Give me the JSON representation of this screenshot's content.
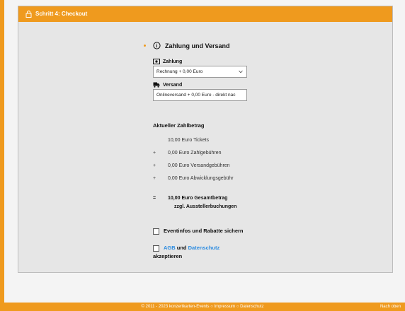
{
  "header": {
    "title": "Schritt 4: Checkout"
  },
  "payment_section": {
    "title": "Zahlung und Versand",
    "payment_label": "Zahlung",
    "payment_value": "Rechnung + 0,00 Euro",
    "shipping_label": "Versand",
    "shipping_value": "Onlineversand + 0,00 Euro - direkt nac"
  },
  "summary": {
    "title": "Aktueller Zahlbetrag",
    "lines": [
      {
        "op": "",
        "text": "10,00 Euro Tickets"
      },
      {
        "op": "+",
        "text": "0,00 Euro Zahlgebühren"
      },
      {
        "op": "+",
        "text": "0,00 Euro Versandgebühren"
      },
      {
        "op": "+",
        "text": "0,00 Euro Abwicklungsgebühr"
      }
    ],
    "total_op": "=",
    "total_text": "10,00 Euro Gesamtbetrag",
    "total_sub": "zzgl. Ausstellerbuchungen"
  },
  "checkboxes": {
    "eventinfo_label": "Eventinfos und Rabatte sichern",
    "agb_link": "AGB",
    "und_text": "und",
    "datenschutz_link": "Datenschutz",
    "accept_text": "akzeptieren"
  },
  "footer": {
    "text": "© 2011 - 2023 konzertkarten-Events ○ Impressum ○ Datenschutz",
    "right_text": "Nach oben"
  },
  "colors": {
    "accent": "#ef9a1e",
    "link": "#2b8be0"
  }
}
